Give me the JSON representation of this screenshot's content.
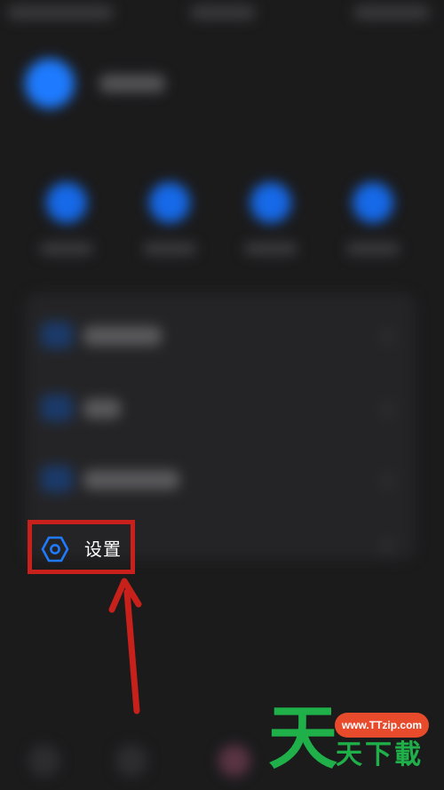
{
  "settings": {
    "label": "设置",
    "icon": "hexagon-gear-icon"
  },
  "watermark": {
    "big_char": "天",
    "url": "www.TTzip.com",
    "text": "天下載"
  },
  "colors": {
    "background": "#1b1b1c",
    "accent_blue": "#1e7bff",
    "highlight_red": "#c8201a",
    "watermark_green": "#20b04a",
    "watermark_orange": "#e84b2b"
  }
}
